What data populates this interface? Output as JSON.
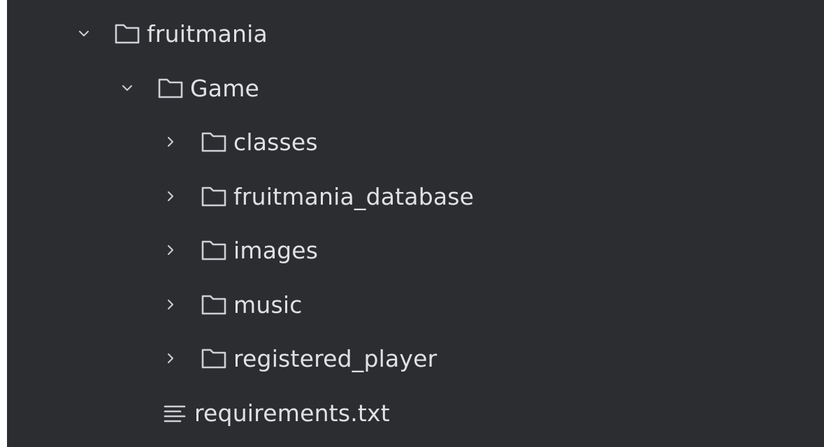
{
  "tree": {
    "root": {
      "label": "fruitmania",
      "expanded": true,
      "icon": "folder-icon",
      "chevron": "chevron-down-icon"
    },
    "game": {
      "label": "Game",
      "expanded": true,
      "icon": "folder-icon",
      "chevron": "chevron-down-icon"
    },
    "children": [
      {
        "label": "classes",
        "expanded": false,
        "icon": "folder-icon",
        "chevron": "chevron-right-icon"
      },
      {
        "label": "fruitmania_database",
        "expanded": false,
        "icon": "folder-icon",
        "chevron": "chevron-right-icon"
      },
      {
        "label": "images",
        "expanded": false,
        "icon": "folder-icon",
        "chevron": "chevron-right-icon"
      },
      {
        "label": "music",
        "expanded": false,
        "icon": "folder-icon",
        "chevron": "chevron-right-icon"
      },
      {
        "label": "registered_player",
        "expanded": false,
        "icon": "folder-icon",
        "chevron": "chevron-right-icon"
      }
    ],
    "file": {
      "label": "requirements.txt",
      "icon": "text-file-icon"
    }
  },
  "colors": {
    "background": "#2b2d30",
    "text": "#dfe1e5",
    "icon": "#ced0d6"
  }
}
